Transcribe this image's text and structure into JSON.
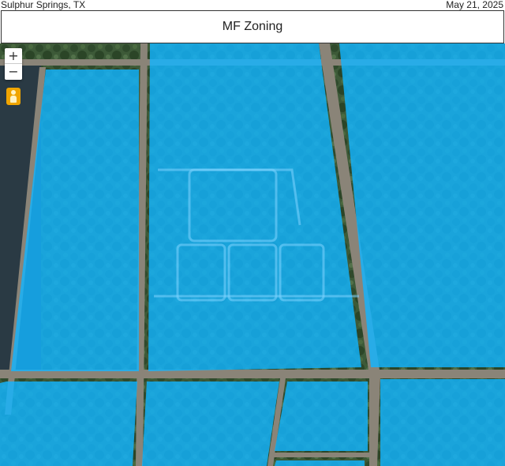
{
  "header": {
    "location": "Sulphur Springs, TX",
    "date": "May 21, 2025",
    "title": "MF Zoning"
  },
  "map_controls": {
    "zoom_in": "+",
    "zoom_out": "−",
    "street_view_icon": "pegman-icon"
  },
  "colors": {
    "zoning_overlay": "#12b4ff",
    "imagery_base": "#3f5a3a",
    "road": "#8a8478"
  }
}
